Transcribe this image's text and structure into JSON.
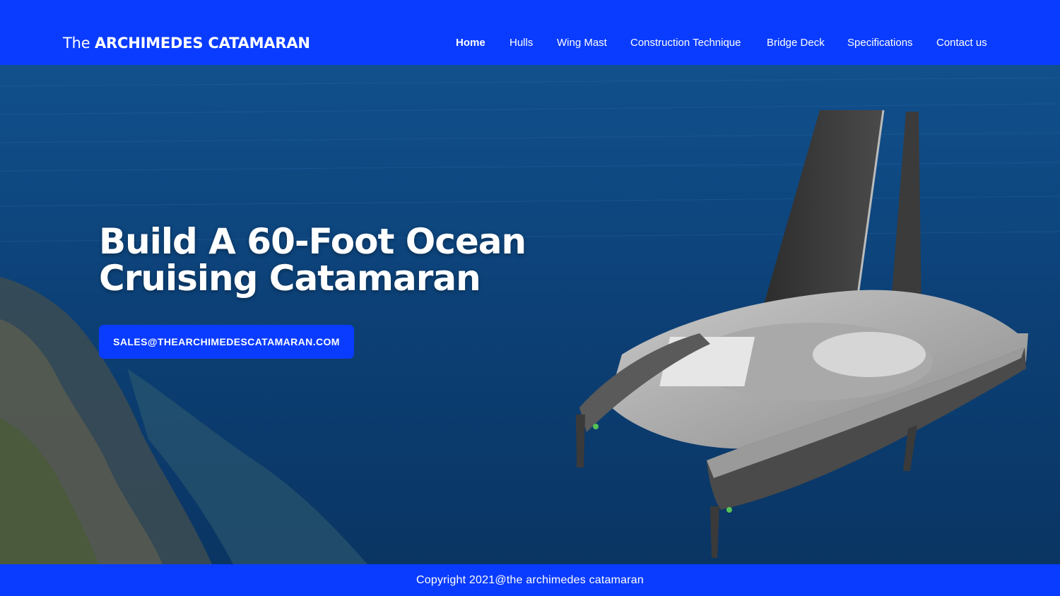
{
  "site": {
    "logo_prefix": "The",
    "logo_bold": "ARCHIMEDES CATAMARAN"
  },
  "nav": {
    "items": [
      {
        "label": "Home",
        "active": true
      },
      {
        "label": "Hulls"
      },
      {
        "label": "Wing Mast"
      },
      {
        "label": "Construction Technique"
      },
      {
        "label": "Bridge Deck"
      },
      {
        "label": "Specifications"
      },
      {
        "label": "Contact us"
      }
    ]
  },
  "hero": {
    "headline_line1": "Build A 60-Foot Ocean",
    "headline_line2": "Cruising Catamaran",
    "cta_label": "SALES@THEARCHIMEDESCATAMARAN.COM",
    "image": "aerial-ocean-catamaran-render"
  },
  "footer": {
    "copyright": "Copyright 2021@the archimedes catamaran"
  },
  "colors": {
    "brand_blue": "#0a3cff",
    "ocean": "#0c3f72",
    "text": "#ffffff"
  }
}
